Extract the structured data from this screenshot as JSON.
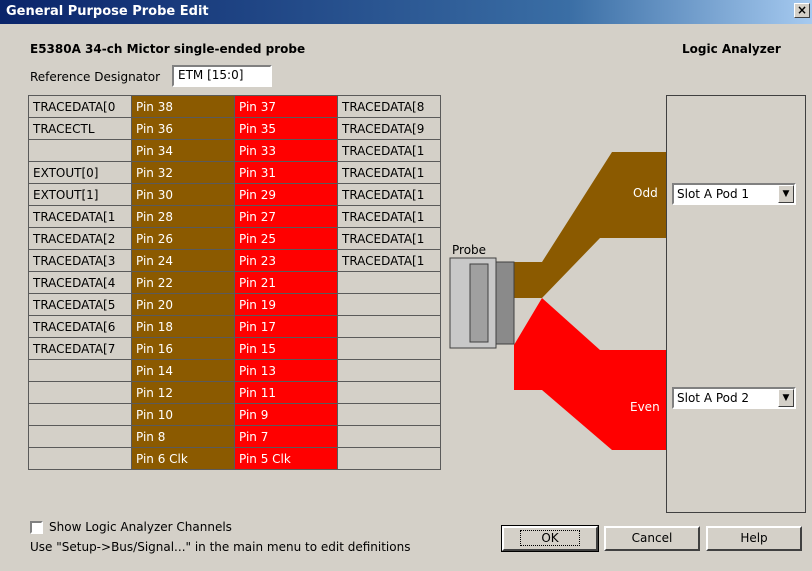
{
  "window": {
    "title": "General Purpose Probe Edit",
    "close_glyph": "×"
  },
  "probe_name": "E5380A 34-ch Mictor single-ended probe",
  "logic_analyzer_title": "Logic Analyzer",
  "reference_designator": {
    "label": "Reference Designator",
    "value": "ETM [15:0]"
  },
  "pin_rows": [
    {
      "left_signal": "TRACEDATA[0",
      "odd_pin": "Pin 38",
      "even_pin": "Pin 37",
      "right_signal": "TRACEDATA[8"
    },
    {
      "left_signal": "TRACECTL",
      "odd_pin": "Pin 36",
      "even_pin": "Pin 35",
      "right_signal": "TRACEDATA[9"
    },
    {
      "left_signal": "",
      "odd_pin": "Pin 34",
      "even_pin": "Pin 33",
      "right_signal": "TRACEDATA[1"
    },
    {
      "left_signal": "EXTOUT[0]",
      "odd_pin": "Pin 32",
      "even_pin": "Pin 31",
      "right_signal": "TRACEDATA[1"
    },
    {
      "left_signal": "EXTOUT[1]",
      "odd_pin": "Pin 30",
      "even_pin": "Pin 29",
      "right_signal": "TRACEDATA[1"
    },
    {
      "left_signal": "TRACEDATA[1",
      "odd_pin": "Pin 28",
      "even_pin": "Pin 27",
      "right_signal": "TRACEDATA[1"
    },
    {
      "left_signal": "TRACEDATA[2",
      "odd_pin": "Pin 26",
      "even_pin": "Pin 25",
      "right_signal": "TRACEDATA[1"
    },
    {
      "left_signal": "TRACEDATA[3",
      "odd_pin": "Pin 24",
      "even_pin": "Pin 23",
      "right_signal": "TRACEDATA[1"
    },
    {
      "left_signal": "TRACEDATA[4",
      "odd_pin": "Pin 22",
      "even_pin": "Pin 21",
      "right_signal": ""
    },
    {
      "left_signal": "TRACEDATA[5",
      "odd_pin": "Pin 20",
      "even_pin": "Pin 19",
      "right_signal": ""
    },
    {
      "left_signal": "TRACEDATA[6",
      "odd_pin": "Pin 18",
      "even_pin": "Pin 17",
      "right_signal": ""
    },
    {
      "left_signal": "TRACEDATA[7",
      "odd_pin": "Pin 16",
      "even_pin": "Pin 15",
      "right_signal": ""
    },
    {
      "left_signal": "",
      "odd_pin": "Pin 14",
      "even_pin": "Pin 13",
      "right_signal": ""
    },
    {
      "left_signal": "",
      "odd_pin": "Pin 12",
      "even_pin": "Pin 11",
      "right_signal": ""
    },
    {
      "left_signal": "",
      "odd_pin": "Pin 10",
      "even_pin": "Pin 9",
      "right_signal": ""
    },
    {
      "left_signal": "",
      "odd_pin": "Pin 8",
      "even_pin": "Pin 7",
      "right_signal": ""
    },
    {
      "left_signal": "",
      "odd_pin": "Pin 6 Clk",
      "even_pin": "Pin 5 Clk",
      "right_signal": ""
    }
  ],
  "connector": {
    "probe_label": "Probe",
    "odd_label": "Odd",
    "even_label": "Even",
    "odd_pod": "Slot A Pod 1",
    "even_pod": "Slot A Pod 2",
    "odd_color": "#8b5a00",
    "even_color": "#ff0000"
  },
  "show_channels_label": "Show Logic Analyzer Channels",
  "show_channels_checked": false,
  "hint": "Use \"Setup->Bus/Signal...\" in the main menu to edit definitions",
  "buttons": {
    "ok": "OK",
    "cancel": "Cancel",
    "help": "Help"
  }
}
